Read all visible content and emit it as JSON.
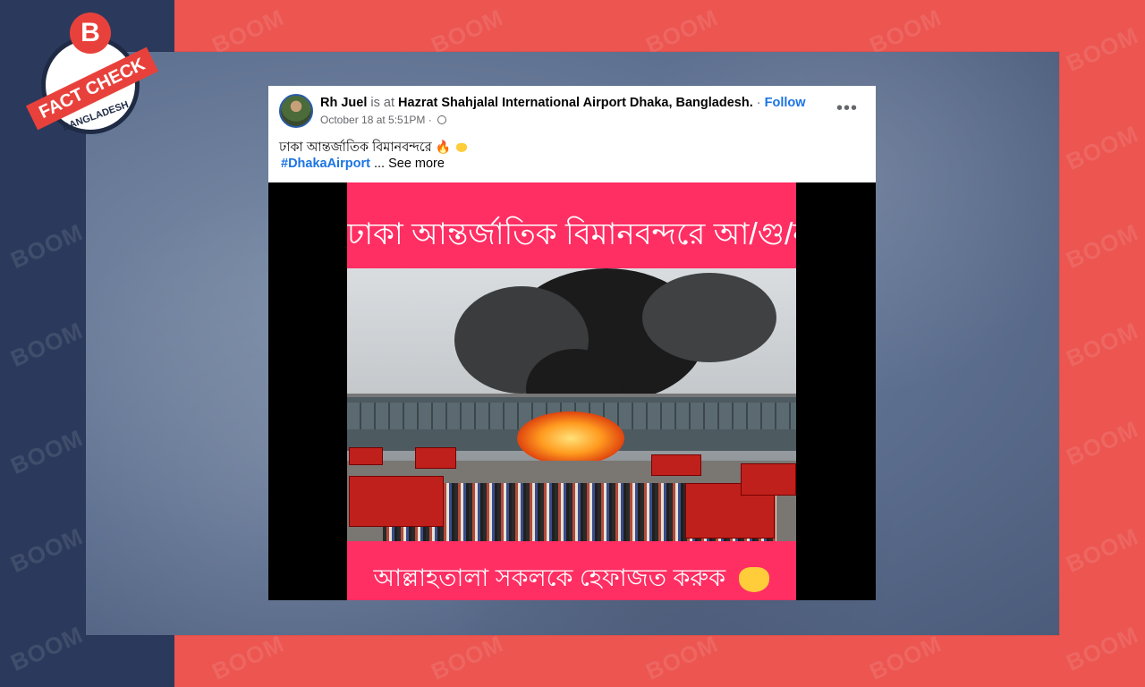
{
  "watermark": "BOOM",
  "badge": {
    "logo_letter": "B",
    "ribbon_text": "FACT CHECK",
    "country": "BANGLADESH"
  },
  "post": {
    "author": "Rh Juel",
    "is_at": "is at",
    "location": "Hazrat Shahjalal International Airport Dhaka, Bangladesh.",
    "separator": "·",
    "follow_label": "Follow",
    "timestamp": "October 18 at 5:51PM",
    "dot": "·",
    "more_label": "•••",
    "caption": "ঢাকা আন্তর্জাতিক বিমানবন্দরে",
    "caption_emoji": "🔥",
    "hashtag": "#DhakaAirport",
    "ellipsis": "...",
    "see_more": "See more"
  },
  "media": {
    "top_banner": "ঢাকা আন্তর্জাতিক বিমানবন্দরে আ/গু/ন",
    "bottom_banner": "আল্লাহতালা সকলকে হেফাজত করুক"
  },
  "colors": {
    "brand_red": "#e8413c",
    "navy": "#2b3a5c",
    "banner_pink": "#ff2e63",
    "link_blue": "#1b74e4"
  }
}
